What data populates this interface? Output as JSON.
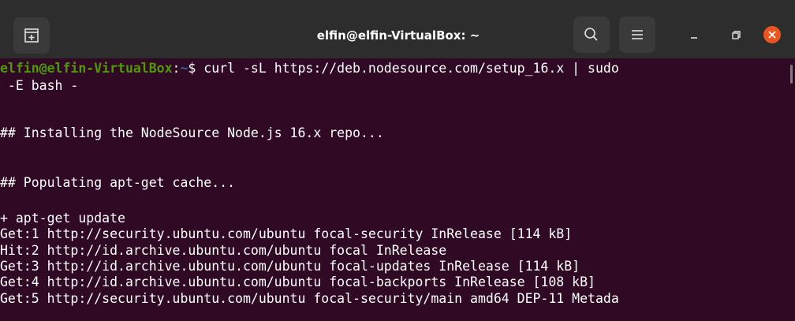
{
  "window": {
    "title": "elfin@elfin-VirtualBox: ~"
  },
  "titlebar": {
    "icons": [
      "new-tab-icon",
      "search-icon",
      "hamburger-menu-icon",
      "minimize-icon",
      "maximize-icon",
      "close-icon"
    ],
    "close_color": "#e95420"
  },
  "terminal": {
    "background": "#300a24",
    "prompt": {
      "user_host": "elfin@elfin-VirtualBox",
      "separator": ":",
      "path": "~",
      "symbol": "$"
    },
    "command": " curl -sL https://deb.nodesource.com/setup_16.x | sudo",
    "command_continued": " -E bash -",
    "lines": [
      "## Installing the NodeSource Node.js 16.x repo...",
      "## Populating apt-get cache...",
      "+ apt-get update",
      "Get:1 http://security.ubuntu.com/ubuntu focal-security InRelease [114 kB]",
      "Hit:2 http://id.archive.ubuntu.com/ubuntu focal InRelease",
      "Get:3 http://id.archive.ubuntu.com/ubuntu focal-updates InRelease [114 kB]",
      "Get:4 http://id.archive.ubuntu.com/ubuntu focal-backports InRelease [108 kB]",
      "Get:5 http://security.ubuntu.com/ubuntu focal-security/main amd64 DEP-11 Metada"
    ]
  }
}
